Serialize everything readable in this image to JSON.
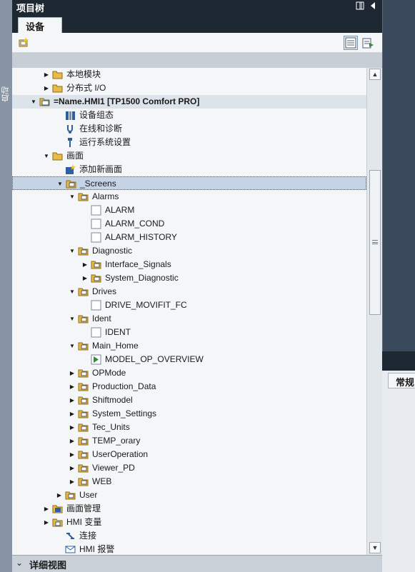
{
  "left_strip": {
    "label": "启动"
  },
  "panel": {
    "title": "项目树",
    "tab": "设备"
  },
  "tree": [
    {
      "label": "本地模块",
      "indent": 0,
      "toggle": "collapsed",
      "icon": "folder-icon"
    },
    {
      "label": "分布式 I/O",
      "indent": 0,
      "toggle": "collapsed",
      "icon": "folder-icon"
    },
    {
      "label": "=Name.HMI1 [TP1500 Comfort PRO]",
      "indent": -1,
      "toggle": "expanded",
      "icon": "hmi-device-icon",
      "header": true
    },
    {
      "label": "设备组态",
      "indent": 1,
      "toggle": "none",
      "icon": "device-config-icon"
    },
    {
      "label": "在线和诊断",
      "indent": 1,
      "toggle": "none",
      "icon": "online-diagnostics-icon"
    },
    {
      "label": "运行系统设置",
      "indent": 1,
      "toggle": "none",
      "icon": "runtime-settings-icon"
    },
    {
      "label": "画面",
      "indent": 0,
      "toggle": "expanded",
      "icon": "folder-icon"
    },
    {
      "label": "添加新画面",
      "indent": 1,
      "toggle": "none",
      "icon": "add-screen-icon"
    },
    {
      "label": "_Screens",
      "indent": 1,
      "toggle": "expanded",
      "icon": "screen-folder-icon",
      "selected": true
    },
    {
      "label": "Alarms",
      "indent": 2,
      "toggle": "expanded",
      "icon": "screen-folder-icon"
    },
    {
      "label": "ALARM",
      "indent": 3,
      "toggle": "none",
      "icon": "screen-icon"
    },
    {
      "label": "ALARM_COND",
      "indent": 3,
      "toggle": "none",
      "icon": "screen-icon"
    },
    {
      "label": "ALARM_HISTORY",
      "indent": 3,
      "toggle": "none",
      "icon": "screen-icon"
    },
    {
      "label": "Diagnostic",
      "indent": 2,
      "toggle": "expanded",
      "icon": "screen-folder-icon"
    },
    {
      "label": "Interface_Signals",
      "indent": 3,
      "toggle": "collapsed",
      "icon": "screen-folder-icon"
    },
    {
      "label": "System_Diagnostic",
      "indent": 3,
      "toggle": "collapsed",
      "icon": "screen-folder-icon"
    },
    {
      "label": "Drives",
      "indent": 2,
      "toggle": "expanded",
      "icon": "screen-folder-icon"
    },
    {
      "label": "DRIVE_MOVIFIT_FC",
      "indent": 3,
      "toggle": "none",
      "icon": "screen-icon"
    },
    {
      "label": "Ident",
      "indent": 2,
      "toggle": "expanded",
      "icon": "screen-folder-icon"
    },
    {
      "label": "IDENT",
      "indent": 3,
      "toggle": "none",
      "icon": "screen-icon"
    },
    {
      "label": "Main_Home",
      "indent": 2,
      "toggle": "expanded",
      "icon": "screen-folder-icon"
    },
    {
      "label": "MODEL_OP_OVERVIEW",
      "indent": 3,
      "toggle": "none",
      "icon": "start-screen-icon"
    },
    {
      "label": "OPMode",
      "indent": 2,
      "toggle": "collapsed",
      "icon": "screen-folder-icon"
    },
    {
      "label": "Production_Data",
      "indent": 2,
      "toggle": "collapsed",
      "icon": "screen-folder-icon"
    },
    {
      "label": "Shiftmodel",
      "indent": 2,
      "toggle": "collapsed",
      "icon": "screen-folder-icon"
    },
    {
      "label": "System_Settings",
      "indent": 2,
      "toggle": "collapsed",
      "icon": "screen-folder-icon"
    },
    {
      "label": "Tec_Units",
      "indent": 2,
      "toggle": "collapsed",
      "icon": "screen-folder-icon"
    },
    {
      "label": "TEMP_orary",
      "indent": 2,
      "toggle": "collapsed",
      "icon": "screen-folder-icon"
    },
    {
      "label": "UserOperation",
      "indent": 2,
      "toggle": "collapsed",
      "icon": "screen-folder-icon"
    },
    {
      "label": "Viewer_PD",
      "indent": 2,
      "toggle": "collapsed",
      "icon": "screen-folder-icon"
    },
    {
      "label": "WEB",
      "indent": 2,
      "toggle": "collapsed",
      "icon": "screen-folder-icon"
    },
    {
      "label": "User",
      "indent": 1,
      "toggle": "collapsed",
      "icon": "screen-folder-icon"
    },
    {
      "label": "画面管理",
      "indent": 0,
      "toggle": "collapsed",
      "icon": "screen-management-icon"
    },
    {
      "label": "HMI 变量",
      "indent": 0,
      "toggle": "collapsed",
      "icon": "hmi-tags-icon"
    },
    {
      "label": "连接",
      "indent": 1,
      "toggle": "none",
      "icon": "connection-icon"
    },
    {
      "label": "HMI 报警",
      "indent": 1,
      "toggle": "none",
      "icon": "hmi-alarms-icon"
    }
  ],
  "details": {
    "label": "详细视图"
  },
  "right_panel": {
    "tab": "常规"
  },
  "colors": {
    "dark": "#1e2833",
    "panel": "#e8ecf0",
    "selected": "#c5d3e5",
    "folder": "#e9b949",
    "accent": "#2f5f9e"
  }
}
